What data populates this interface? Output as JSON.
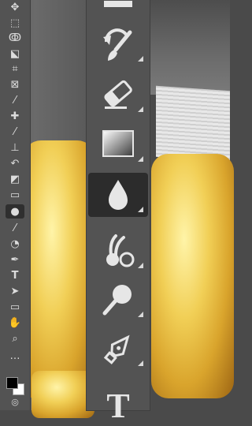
{
  "app": {
    "name": "Photoshop tools panel (zoomed)"
  },
  "mini_toolbar": {
    "items": [
      {
        "name": "move-tool",
        "glyph": "✥"
      },
      {
        "name": "rectangular-marquee-tool",
        "glyph": "⬚"
      },
      {
        "name": "lasso-tool",
        "glyph": "ↂ"
      },
      {
        "name": "object-selection-tool",
        "glyph": "⬕"
      },
      {
        "name": "crop-tool",
        "glyph": "⌗"
      },
      {
        "name": "frame-tool",
        "glyph": "⊠"
      },
      {
        "name": "eyedropper-tool",
        "glyph": "⁄"
      },
      {
        "name": "spot-healing-brush-tool",
        "glyph": "✚"
      },
      {
        "name": "brush-tool",
        "glyph": "⁄"
      },
      {
        "name": "clone-stamp-tool",
        "glyph": "⊥"
      },
      {
        "name": "history-brush-tool",
        "glyph": "↶"
      },
      {
        "name": "eraser-tool",
        "glyph": "◩"
      },
      {
        "name": "gradient-tool",
        "glyph": "▭"
      },
      {
        "name": "blur-tool",
        "glyph": "●"
      },
      {
        "name": "smudge-tool",
        "glyph": "⁄"
      },
      {
        "name": "dodge-tool",
        "glyph": "◔"
      },
      {
        "name": "pen-tool",
        "glyph": "✒"
      },
      {
        "name": "type-tool",
        "glyph": "T"
      },
      {
        "name": "path-selection-tool",
        "glyph": "➤"
      },
      {
        "name": "rectangle-tool",
        "glyph": "▭"
      },
      {
        "name": "hand-tool",
        "glyph": "✋"
      },
      {
        "name": "zoom-tool",
        "glyph": "⌕"
      },
      {
        "name": "edit-toolbar",
        "glyph": "…"
      }
    ],
    "active_index": 13
  },
  "big_toolbar": {
    "items": [
      {
        "name": "gradient-tool-top"
      },
      {
        "name": "history-brush-tool"
      },
      {
        "name": "eraser-tool"
      },
      {
        "name": "gradient-tool"
      },
      {
        "name": "blur-tool"
      },
      {
        "name": "smudge-tool"
      },
      {
        "name": "dodge-tool"
      },
      {
        "name": "pen-tool"
      },
      {
        "name": "type-tool"
      }
    ],
    "active_index": 4,
    "type_label": "T"
  },
  "colors": {
    "panel": "#535353",
    "active": "#2c2c2c",
    "icon": "#d9d9d9",
    "foreground_swatch": "#000000",
    "background_swatch": "#ffffff"
  }
}
